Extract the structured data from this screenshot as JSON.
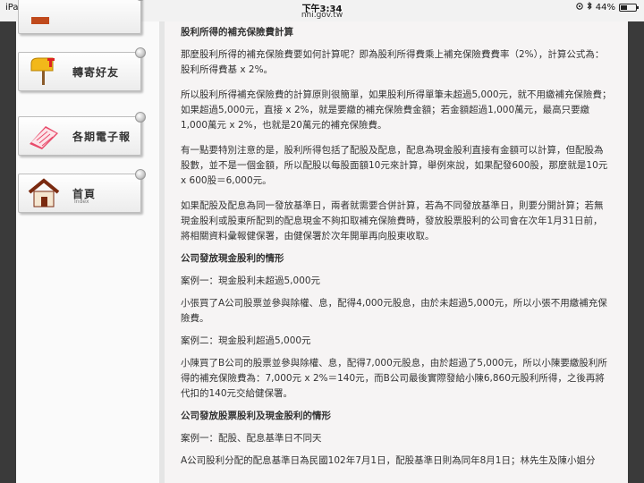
{
  "status_bar": {
    "device": "iPad",
    "time": "下午3:34",
    "url": "nhi.gov.tw",
    "battery": "44%",
    "battery_level": 0.44
  },
  "sidebar": {
    "items": [
      {
        "label": "轉寄好友",
        "sub": ""
      },
      {
        "label": "各期電子報",
        "sub": ""
      },
      {
        "label": "首頁",
        "sub": "Index"
      }
    ]
  },
  "content": {
    "title": "股利所得的補充保險費計算",
    "p1": "那麼股利所得的補充保險費要如何計算呢？即為股利所得費乘上補充保險費費率（2%），計算公式為：股利所得費基 x 2%。",
    "p2": "所以股利所得補充保險費的計算原則很簡單，如果股利所得單筆未超過5,000元，就不用繳補充保險費；如果超過5,000元，直接 x 2%，就是要繳的補充保險費金額；若金額超過1,000萬元，最高只要繳1,000萬元 x 2%，也就是20萬元的補充保險費。",
    "p3": "有一點要特別注意的是，股利所得包括了配股及配息，配息為現金股利直接有金額可以計算，但配股為股數，並不是一個金額，所以配股以每股面額10元來計算，舉例來說，如果配發600股，那麼就是10元x 600股＝6,000元。",
    "p4": "如果配股及配息為同一發放基準日，兩者就需要合併計算，若為不同發放基準日，則要分開計算；若無現金股利或股東所配到的配息現金不夠扣取補充保險費時，發放股票股利的公司會在次年1月31日前，將相關資料彙報健保署，由健保署於次年開單再向股東收取。",
    "h1": "公司發放現金股利的情形",
    "case1": "案例一：現金股利未超過5,000元",
    "c1_text": "小張買了A公司股票並參與除權、息，配得4,000元股息，由於未超過5,000元，所以小張不用繳補充保險費。",
    "case2": "案例二：現金股利超過5,000元",
    "c2_text": "小陳買了B公司的股票並參與除權、息，配得7,000元股息，由於超過了5,000元，所以小陳要繳股利所得的補充保險費為：7,000元 x 2%＝140元，而B公司最後實際發給小陳6,860元股利所得，之後再將代扣的140元交給健保署。",
    "h2": "公司發放股票股利及現金股利的情形",
    "case3": "案例一：配股、配息基準日不同天",
    "c3_text": "A公司股利分配的配息基準日為民國102年7月1日，配股基準日則為同年8月1日；林先生及陳小姐分"
  },
  "colors": {
    "heading": "#8b1a1a",
    "case": "#b0281c",
    "body_text": "#333333"
  }
}
